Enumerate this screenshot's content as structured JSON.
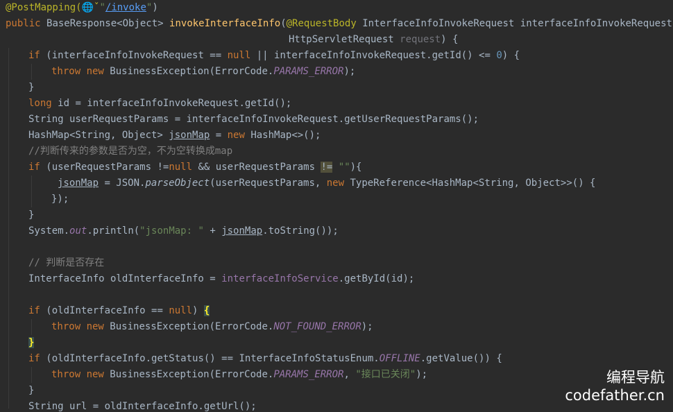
{
  "code_lines": [
    [
      [
        "@PostMapping(",
        "ann"
      ],
      [
        "🌐",
        "globe"
      ],
      [
        "ˇ",
        "ann"
      ],
      [
        "\"",
        "str"
      ],
      [
        "/invoke",
        "link"
      ],
      [
        "\"",
        "str"
      ],
      [
        ")",
        ""
      ]
    ],
    [
      [
        "public ",
        "kw"
      ],
      [
        "BaseResponse<Object> ",
        ""
      ],
      [
        "invokeInterfaceInfo",
        "fn"
      ],
      [
        "(",
        ""
      ],
      [
        "@RequestBody ",
        "ann"
      ],
      [
        "InterfaceInfoInvokeRequest interfaceInfoInvokeRequest,",
        ""
      ]
    ],
    [
      [
        "HttpServletRequest ",
        ""
      ],
      [
        "request",
        "unused"
      ],
      [
        ") {",
        ""
      ]
    ],
    [
      [
        "if ",
        "kw"
      ],
      [
        "(interfaceInfoInvokeRequest == ",
        ""
      ],
      [
        "null",
        "kw"
      ],
      [
        " || interfaceInfoInvokeRequest.getId() <= ",
        ""
      ],
      [
        "0",
        "num"
      ],
      [
        ") {",
        ""
      ]
    ],
    [
      [
        "throw new ",
        "kw"
      ],
      [
        "BusinessException(ErrorCode.",
        ""
      ],
      [
        "PARAMS_ERROR",
        "st"
      ],
      [
        ");",
        ""
      ]
    ],
    [
      [
        "}",
        ""
      ]
    ],
    [
      [
        "long ",
        "kw"
      ],
      [
        "id = interfaceInfoInvokeRequest.getId();",
        ""
      ]
    ],
    [
      [
        "String userRequestParams = interfaceInfoInvokeRequest.getUserRequestParams();",
        ""
      ]
    ],
    [
      [
        "HashMap<String, Object> ",
        ""
      ],
      [
        "jsonMap",
        "u"
      ],
      [
        " = ",
        ""
      ],
      [
        "new ",
        "kw"
      ],
      [
        "HashMap<>();",
        ""
      ]
    ],
    [
      [
        "//判断传来的参数是否为空，不为空转换成map",
        "cmt"
      ]
    ],
    [
      [
        "if ",
        "kw"
      ],
      [
        "(userRequestParams !=",
        ""
      ],
      [
        "null",
        "kw"
      ],
      [
        " && userRequestParams ",
        ""
      ],
      [
        "!=",
        "warn"
      ],
      [
        " ",
        ""
      ],
      [
        "\"\"",
        "str"
      ],
      [
        "){",
        ""
      ]
    ],
    [
      [
        "jsonMap",
        "u"
      ],
      [
        " = JSON.",
        ""
      ],
      [
        "parseObject",
        "it"
      ],
      [
        "(userRequestParams, ",
        ""
      ],
      [
        "new ",
        "kw"
      ],
      [
        "TypeReference<HashMap<String, Object>>() {",
        ""
      ]
    ],
    [
      [
        "});",
        ""
      ]
    ],
    [
      [
        "}",
        ""
      ]
    ],
    [
      [
        "System.",
        ""
      ],
      [
        "out",
        "st"
      ],
      [
        ".println(",
        ""
      ],
      [
        "\"jsonMap: \"",
        "str"
      ],
      [
        " + ",
        ""
      ],
      [
        "jsonMap",
        "u"
      ],
      [
        ".toString());",
        ""
      ]
    ],
    [],
    [
      [
        "// 判断是否存在",
        "cmt"
      ]
    ],
    [
      [
        "InterfaceInfo oldInterfaceInfo = ",
        ""
      ],
      [
        "interfaceInfoService",
        "fld"
      ],
      [
        ".getById(id);",
        ""
      ]
    ],
    [],
    [
      [
        "if ",
        "kw"
      ],
      [
        "(oldInterfaceInfo == ",
        ""
      ],
      [
        "null",
        "kw"
      ],
      [
        ") ",
        ""
      ],
      [
        "{",
        "br"
      ]
    ],
    [
      [
        "throw new ",
        "kw"
      ],
      [
        "BusinessException(ErrorCode.",
        ""
      ],
      [
        "NOT_FOUND_ERROR",
        "st"
      ],
      [
        ");",
        ""
      ]
    ],
    [
      [
        "}",
        "br"
      ]
    ],
    [
      [
        "if ",
        "kw"
      ],
      [
        "(oldInterfaceInfo.getStatus() == InterfaceInfoStatusEnum.",
        ""
      ],
      [
        "OFFLINE",
        "st"
      ],
      [
        ".getValue()) {",
        ""
      ]
    ],
    [
      [
        "throw new ",
        "kw"
      ],
      [
        "BusinessException(ErrorCode.",
        ""
      ],
      [
        "PARAMS_ERROR",
        "st"
      ],
      [
        ", ",
        ""
      ],
      [
        "\"接口已关闭\"",
        "str"
      ],
      [
        ");",
        ""
      ]
    ],
    [
      [
        "}",
        ""
      ]
    ],
    [
      [
        "String url = oldInterfaceInfo.getUrl();",
        ""
      ]
    ]
  ],
  "watermark": {
    "line1": "编程导航",
    "line2": "codefather.cn"
  }
}
